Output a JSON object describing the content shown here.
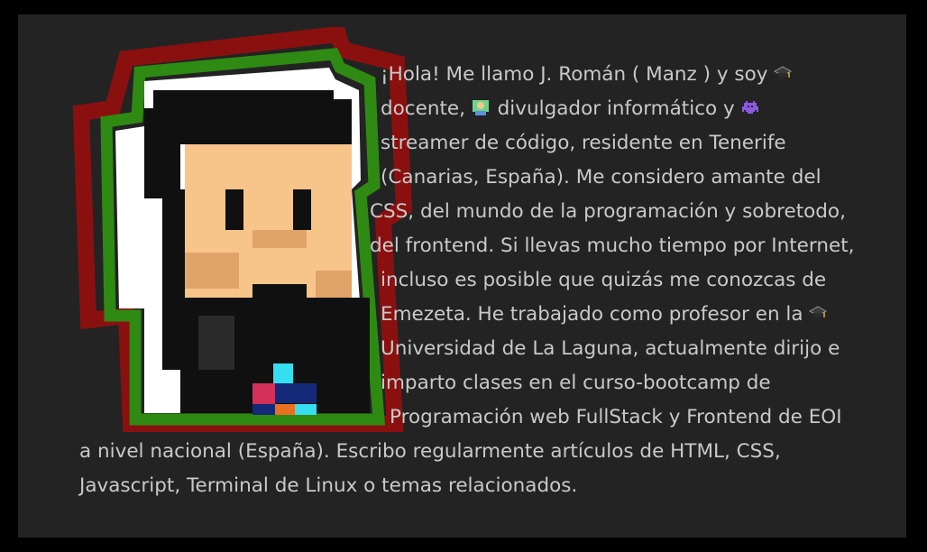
{
  "bio": {
    "lines": [
      "¡Hola! Me llamo J. Román ( Manz ) y soy",
      "docente,",
      "divulgador informático y",
      "streamer de código, residente en Tenerife",
      "(Canarias, España). Me considero amante del",
      "CSS, del mundo de la programación y sobretodo,",
      "del frontend. Si llevas mucho tiempo por Internet,",
      "incluso es posible que quizás me conozcas de",
      "Emezeta. He trabajado como profesor en la",
      "Universidad de La Laguna, actualmente dirijo e",
      "imparto clases en el curso-bootcamp de",
      "Programación web FullStack y Frontend de EOI",
      "a nivel nacional (España). Escribo regularmente artículos de HTML, CSS,",
      "Javascript, Terminal de Linux o temas relacionados."
    ]
  },
  "icons": {
    "teacher": "graduation-cap-icon",
    "developer": "technologist-icon",
    "streamer": "space-invader-icon"
  },
  "colors": {
    "background": "#000000",
    "panel": "#232323",
    "text": "#c9c9c9",
    "outline_red": "#8a1010",
    "outline_green": "#2e8a12"
  }
}
